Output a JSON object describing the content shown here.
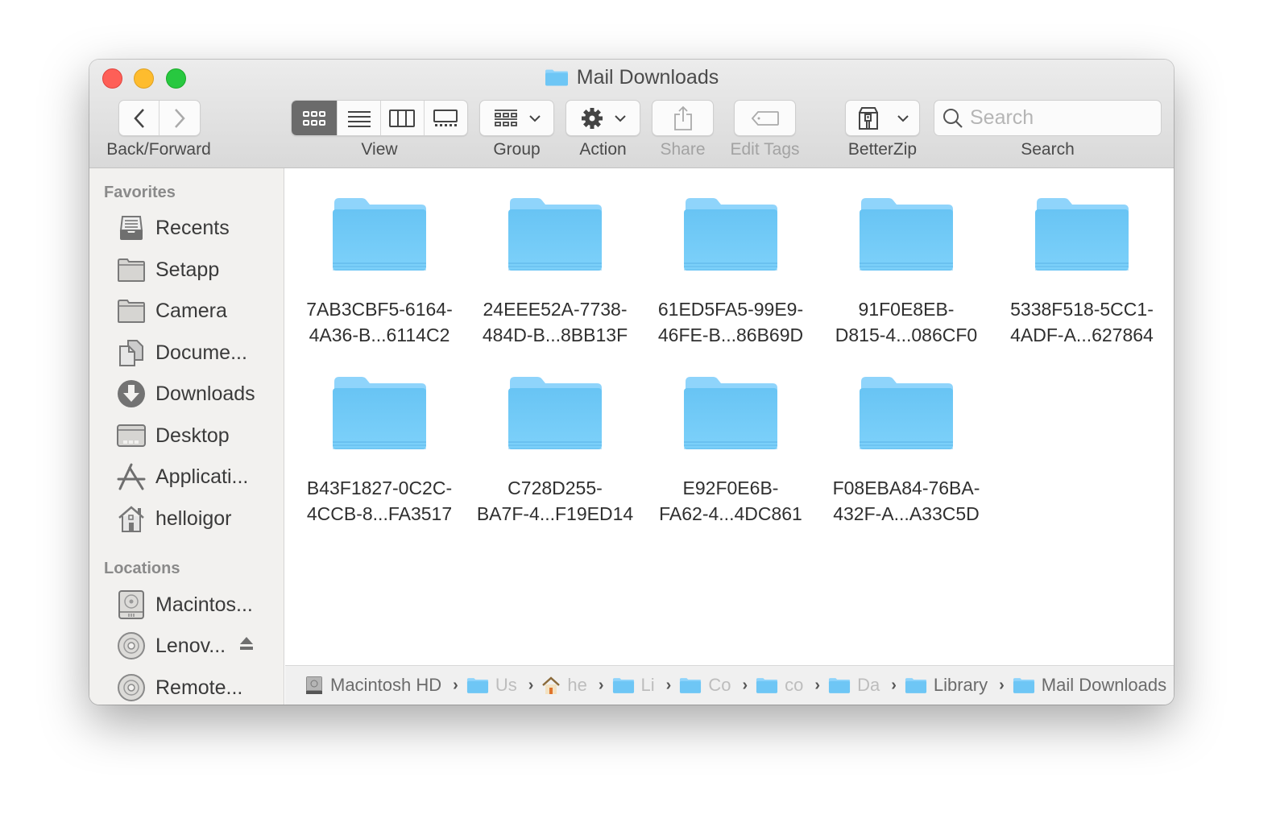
{
  "window": {
    "title": "Mail Downloads",
    "controls": [
      "close",
      "minimize",
      "zoom"
    ]
  },
  "toolbar": {
    "back_forward_label": "Back/Forward",
    "view_label": "View",
    "view_modes": [
      "icon",
      "list",
      "column",
      "gallery"
    ],
    "view_active": "icon",
    "group_label": "Group",
    "action_label": "Action",
    "share_label": "Share",
    "edit_tags_label": "Edit Tags",
    "betterzip_label": "BetterZip",
    "search_label": "Search",
    "search_placeholder": "Search",
    "search_value": ""
  },
  "sidebar": {
    "favorites_header": "Favorites",
    "favorites": [
      {
        "label": "Recents",
        "icon": "recents-icon"
      },
      {
        "label": "Setapp",
        "icon": "folder-icon"
      },
      {
        "label": "Camera",
        "icon": "folder-icon"
      },
      {
        "label": "Docume...",
        "icon": "documents-icon"
      },
      {
        "label": "Downloads",
        "icon": "downloads-icon"
      },
      {
        "label": "Desktop",
        "icon": "desktop-icon"
      },
      {
        "label": "Applicati...",
        "icon": "applications-icon"
      },
      {
        "label": "helloigor",
        "icon": "home-icon"
      }
    ],
    "locations_header": "Locations",
    "locations": [
      {
        "label": "Macintos...",
        "icon": "hard-drive-icon"
      },
      {
        "label": "Lenov...",
        "icon": "disc-icon",
        "ejectable": true
      },
      {
        "label": "Remote...",
        "icon": "disc-icon"
      }
    ]
  },
  "files": [
    {
      "line1": "7AB3CBF5-6164-",
      "line2": "4A36-B...6114C2"
    },
    {
      "line1": "24EEE52A-7738-",
      "line2": "484D-B...8BB13F"
    },
    {
      "line1": "61ED5FA5-99E9-",
      "line2": "46FE-B...86B69D"
    },
    {
      "line1": "91F0E8EB-",
      "line2": "D815-4...086CF0"
    },
    {
      "line1": "5338F518-5CC1-",
      "line2": "4ADF-A...627864"
    },
    {
      "line1": "B43F1827-0C2C-",
      "line2": "4CCB-8...FA3517"
    },
    {
      "line1": "C728D255-",
      "line2": "BA7F-4...F19ED14"
    },
    {
      "line1": "E92F0E6B-",
      "line2": "FA62-4...4DC861"
    },
    {
      "line1": "F08EBA84-76BA-",
      "line2": "432F-A...A33C5D"
    }
  ],
  "pathbar": [
    {
      "label": "Macintosh HD",
      "icon": "hard-drive-icon",
      "truncated": false
    },
    {
      "label": "Us",
      "icon": "users-folder-icon",
      "truncated": true
    },
    {
      "label": "he",
      "icon": "home-icon",
      "truncated": true
    },
    {
      "label": "Li",
      "icon": "library-folder-icon",
      "truncated": true
    },
    {
      "label": "Co",
      "icon": "folder-icon",
      "truncated": true
    },
    {
      "label": "co",
      "icon": "folder-icon",
      "truncated": true
    },
    {
      "label": "Da",
      "icon": "folder-icon",
      "truncated": true
    },
    {
      "label": "Library",
      "icon": "folder-icon",
      "truncated": false
    },
    {
      "label": "Mail Downloads",
      "icon": "folder-icon",
      "truncated": false
    }
  ],
  "colors": {
    "folder_blue": "#6ec6f5",
    "close": "#fe5f57",
    "minimize": "#febc2e",
    "zoom": "#28c840"
  }
}
